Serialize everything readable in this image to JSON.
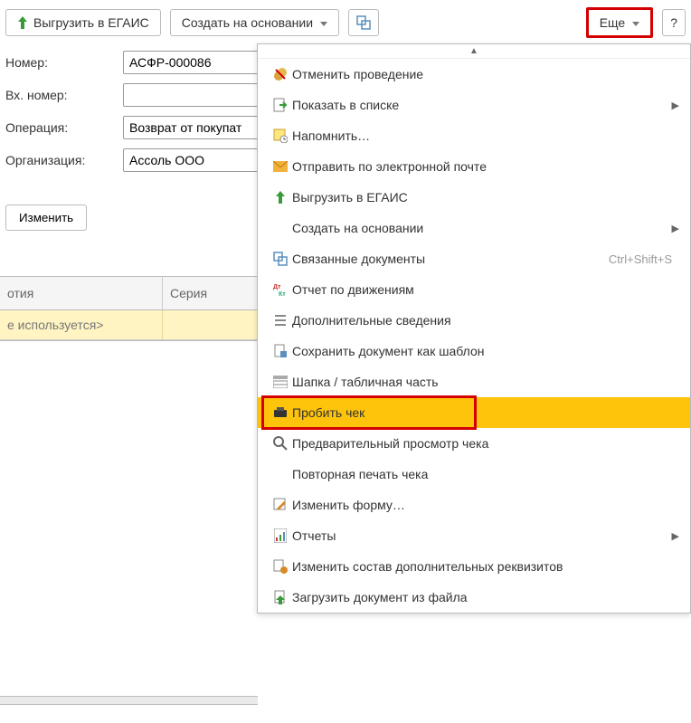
{
  "toolbar": {
    "upload_label": "Выгрузить в ЕГАИС",
    "create_based_label": "Создать на основании",
    "more_label": "Еще",
    "help_label": "?"
  },
  "form": {
    "number_label": "Номер:",
    "number_value": "АСФР-000086",
    "in_number_label": "Вх. номер:",
    "in_number_value": "",
    "operation_label": "Операция:",
    "operation_value": "Возврат от покупат",
    "org_label": "Организация:",
    "org_value": "Ассоль ООО",
    "change_label": "Изменить"
  },
  "grid": {
    "col1_header": "отия",
    "col2_header": "Серия",
    "row1_col1": "е используется>",
    "row1_col2": ""
  },
  "menu": {
    "items": [
      {
        "label": "Отменить проведение",
        "shortcut": "",
        "arrow": false
      },
      {
        "label": "Показать в списке",
        "shortcut": "",
        "arrow": true
      },
      {
        "label": "Напомнить…",
        "shortcut": "",
        "arrow": false
      },
      {
        "label": "Отправить по электронной почте",
        "shortcut": "",
        "arrow": false
      },
      {
        "label": "Выгрузить в ЕГАИС",
        "shortcut": "",
        "arrow": false
      },
      {
        "label": "Создать на основании",
        "shortcut": "",
        "arrow": true
      },
      {
        "label": "Связанные документы",
        "shortcut": "Ctrl+Shift+S",
        "arrow": false
      },
      {
        "label": "Отчет по движениям",
        "shortcut": "",
        "arrow": false
      },
      {
        "label": "Дополнительные сведения",
        "shortcut": "",
        "arrow": false
      },
      {
        "label": "Сохранить документ как шаблон",
        "shortcut": "",
        "arrow": false
      },
      {
        "label": "Шапка / табличная часть",
        "shortcut": "",
        "arrow": false
      },
      {
        "label": "Пробить чек",
        "shortcut": "",
        "arrow": false
      },
      {
        "label": "Предварительный просмотр чека",
        "shortcut": "",
        "arrow": false
      },
      {
        "label": "Повторная печать чека",
        "shortcut": "",
        "arrow": false
      },
      {
        "label": "Изменить форму…",
        "shortcut": "",
        "arrow": false
      },
      {
        "label": "Отчеты",
        "shortcut": "",
        "arrow": true
      },
      {
        "label": "Изменить состав дополнительных реквизитов",
        "shortcut": "",
        "arrow": false
      },
      {
        "label": "Загрузить документ из файла",
        "shortcut": "",
        "arrow": false
      }
    ]
  }
}
